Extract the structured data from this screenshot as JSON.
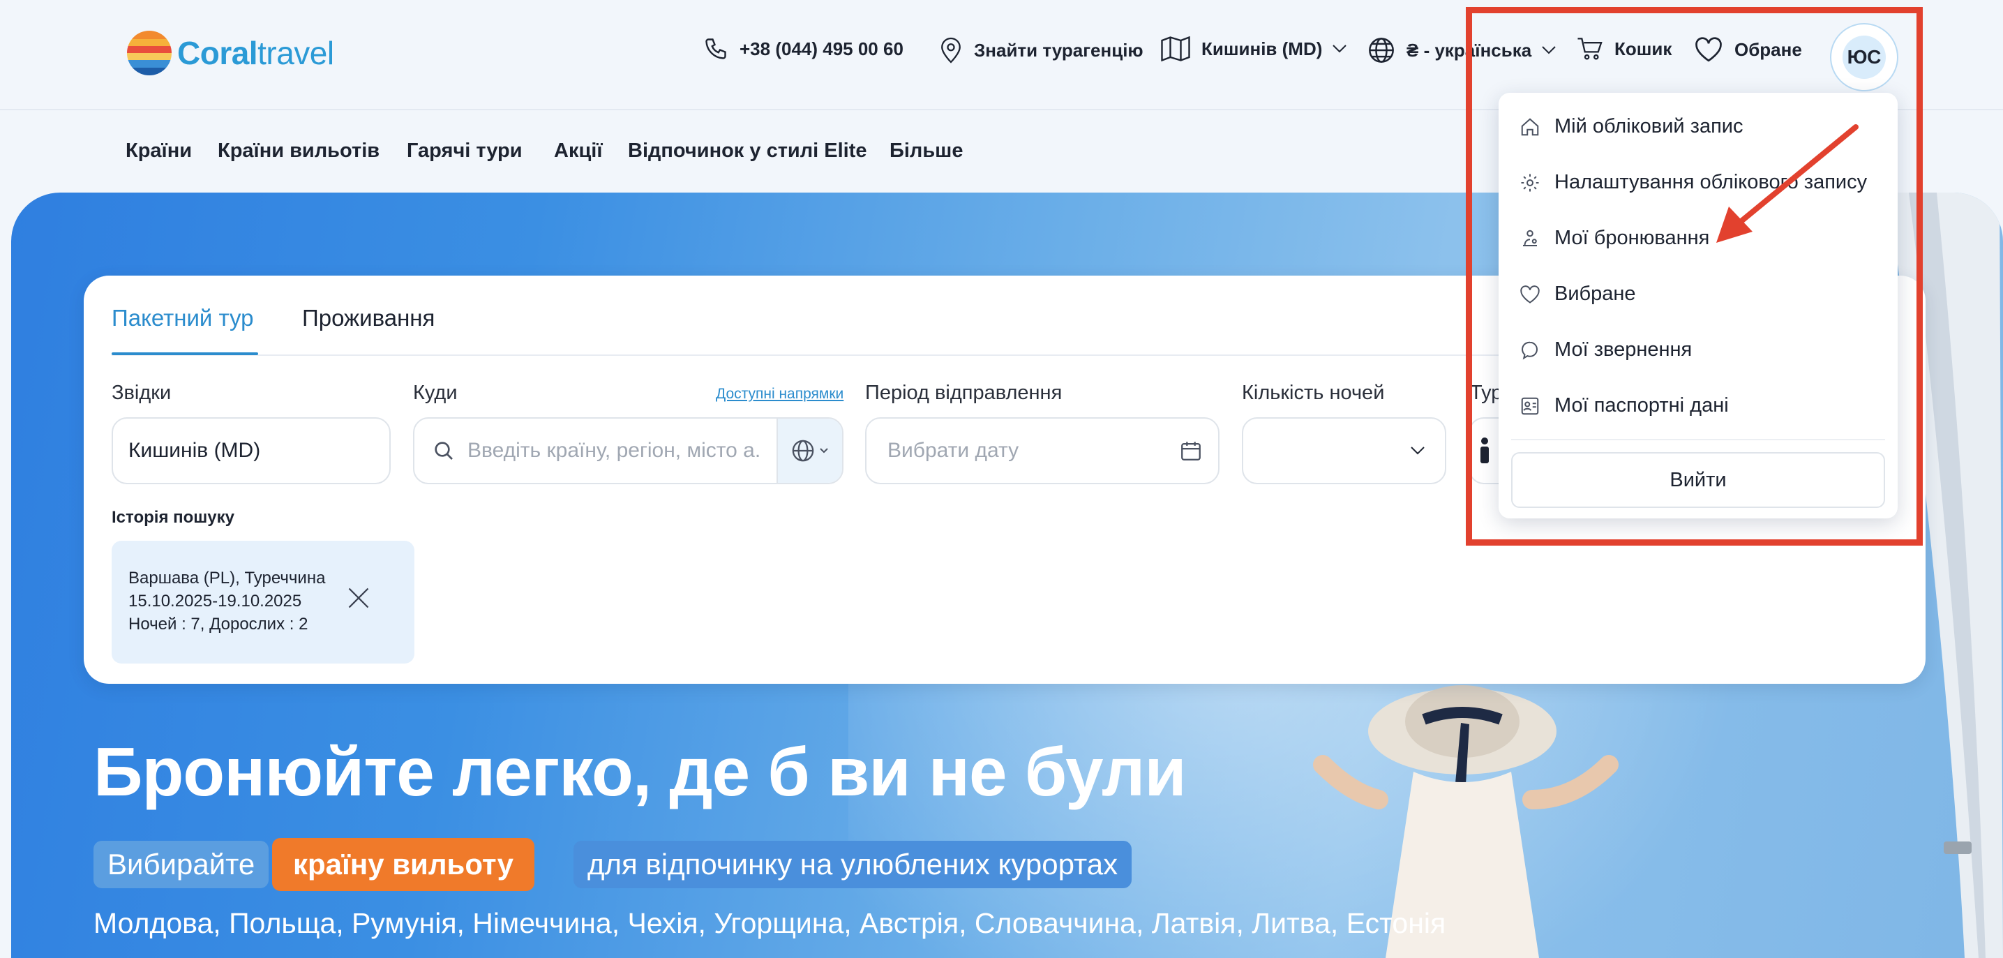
{
  "header": {
    "logo": {
      "brand_bold": "Coral",
      "brand_light": "travel"
    },
    "phone": "+38 (044) 495 00 60",
    "find_agency": "Знайти турагенцію",
    "city": "Кишинів (MD)",
    "currency_lang": "₴ - українська",
    "cart": "Кошик",
    "favorites": "Обране",
    "avatar_initials": "ЮС"
  },
  "nav": {
    "items": [
      "Країни",
      "Країни вильотів",
      "Гарячі тури",
      "Акції",
      "Відпочинок у стилі Elite",
      "Більше"
    ]
  },
  "search": {
    "tabs": [
      "Пакетний тур",
      "Проживання"
    ],
    "active_tab": "Пакетний тур",
    "from_label": "Звідки",
    "from_value": "Кишинів (MD)",
    "to_label": "Куди",
    "to_link": "Доступні напрямки",
    "to_placeholder": "Введіть країну, регіон, місто а...",
    "period_label": "Період відправлення",
    "period_placeholder": "Вибрати дату",
    "nights_label": "Кількість ночей",
    "tourists_label": "Тур",
    "history_label": "Історія пошуку",
    "history": {
      "route": "Варшава (PL), Туреччина",
      "dates": "15.10.2025-19.10.2025",
      "details": "Ночей : 7, Дорослих : 2"
    }
  },
  "hero": {
    "title": "Бронюйте легко, де б ви не були",
    "pill_1": "Вибирайте",
    "pill_2": "країну вильоту",
    "pill_3": "для відпочинку на улюблених курортах",
    "countries": "Молдова, Польща, Румунія, Німеччина, Чехія, Угорщина, Австрія, Словаччина, Латвія, Литва, Естонія"
  },
  "account_menu": {
    "items": [
      {
        "label": "Мій обліковий запис",
        "icon": "home-icon"
      },
      {
        "label": "Налаштування облікового запису",
        "icon": "gear-icon"
      },
      {
        "label": "Мої бронювання",
        "icon": "booking-icon"
      },
      {
        "label": "Вибране",
        "icon": "heart-icon"
      },
      {
        "label": "Мої звернення",
        "icon": "chat-icon"
      },
      {
        "label": "Мої паспортні дані",
        "icon": "passport-icon"
      }
    ],
    "logout": "Вийти"
  },
  "colors": {
    "accent": "#2b8ccd",
    "orange": "#f07a2a",
    "annotation_red": "#e2412e",
    "hero_blue": "#2f7fe0"
  }
}
